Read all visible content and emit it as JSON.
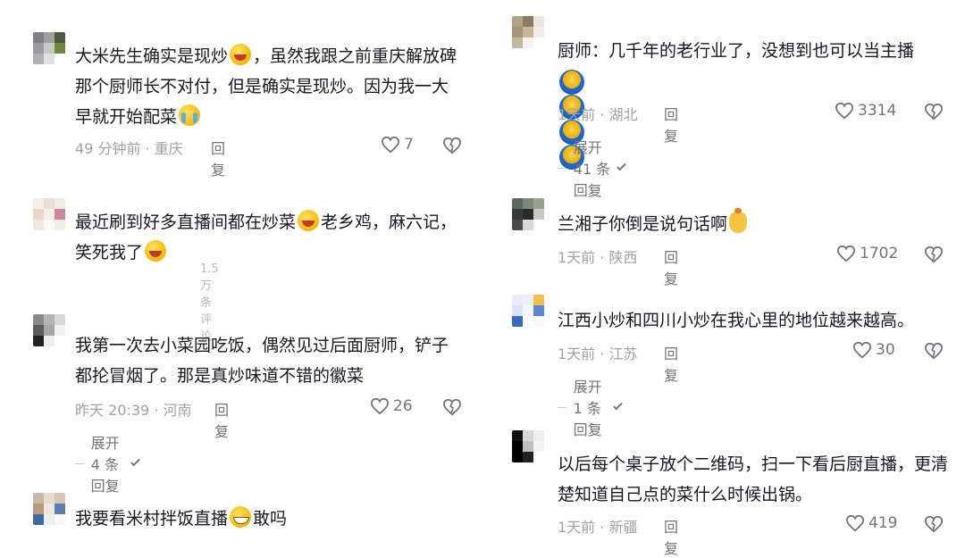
{
  "left": [
    {
      "text_parts": [
        "大米先生确实是现炒",
        "laugh",
        "，虽然我跟之前重庆解放碑那个厨师长不对付，但是确实是现炒。因为我一大早就开始配菜",
        "cry"
      ],
      "time": "49 分钟前 · 重庆",
      "reply": "回复",
      "likes": "7"
    },
    {
      "text_parts": [
        "最近刷到好多直播间都在炒菜",
        "laugh",
        "老乡鸡，麻六记，笑死我了",
        "laugh"
      ],
      "fragment": "1.5万条评论"
    },
    {
      "text_parts": [
        "我第一次去小菜园吃饭，偶然见过后面厨师，铲子都抡冒烟了。那是真炒味道不错的徽菜"
      ],
      "time": "昨天 20:39 · 河南",
      "reply": "回复",
      "likes": "26",
      "expand": "展开 4 条回复"
    },
    {
      "text_parts": [
        "我要看米村拌饭直播",
        "grin",
        "敢吗"
      ]
    }
  ],
  "right": [
    {
      "text_parts": [
        "厨师：几千年的老行业了，没想到也可以当主播"
      ],
      "emoji_row": [
        "blue",
        "blue",
        "blue",
        "blue"
      ],
      "time": "1天前 · 湖北",
      "reply": "回复",
      "likes": "3314",
      "expand": "展开 41 条回复"
    },
    {
      "text_parts": [
        "兰湘子你倒是说句话啊",
        "bag"
      ],
      "time": "1天前 · 陕西",
      "reply": "回复",
      "likes": "1702"
    },
    {
      "text_parts": [
        "江西小炒和四川小炒在我心里的地位越来越高。"
      ],
      "time": "1天前 · 江苏",
      "reply": "回复",
      "likes": "30",
      "expand": "展开 1 条回复"
    },
    {
      "text_parts": [
        "以后每个桌子放个二维码，扫一下看后厨直播，更清楚知道自己点的菜什么时候出锅。"
      ],
      "time": "1天前 · 新疆",
      "reply": "回复",
      "likes": "419"
    }
  ],
  "icons": {
    "like": "heart-outline-icon",
    "dislike": "broken-heart-icon",
    "chevron": "chevron-down-icon"
  },
  "colors": {
    "text": "#161823",
    "meta": "#a1a2a7",
    "action": "#73757b"
  }
}
